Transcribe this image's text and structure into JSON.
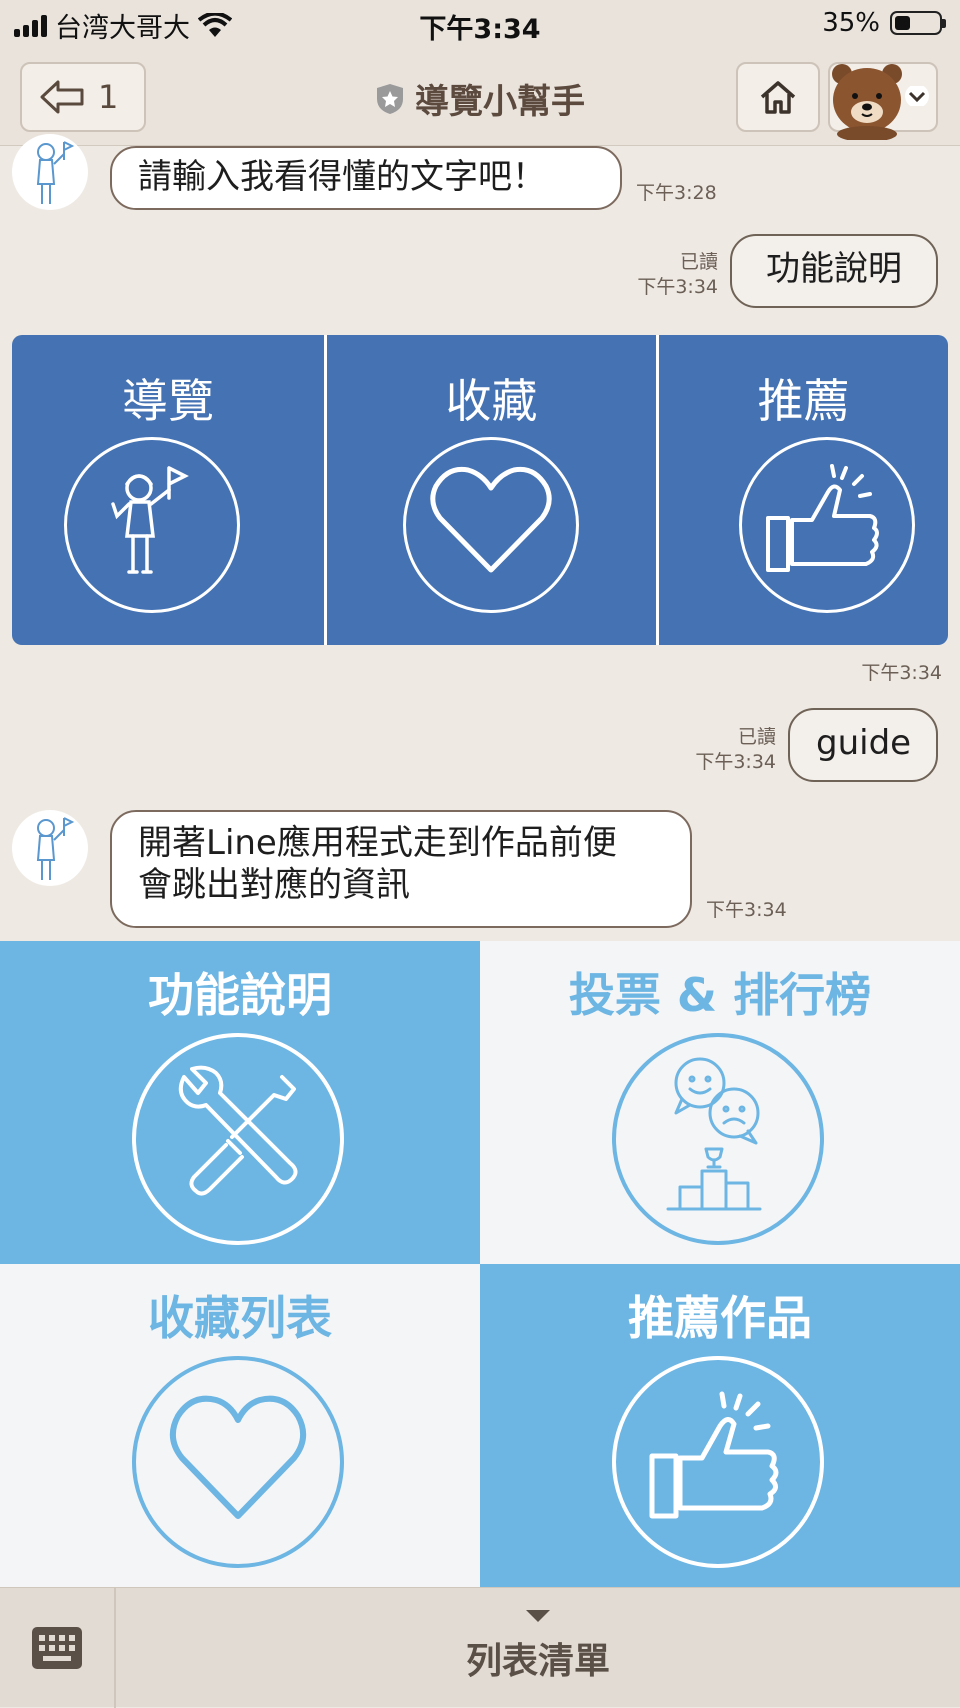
{
  "status_bar": {
    "carrier": "台湾大哥大",
    "time": "下午3:34",
    "battery_percent": "35%",
    "battery_level": 0.35
  },
  "header": {
    "back_count": "1",
    "title": "導覽小幫手"
  },
  "messages": [
    {
      "from": "bot",
      "text": "請輸入我看得懂的文字吧！",
      "time": "下午3:28"
    },
    {
      "from": "user",
      "text": "功能說明",
      "read": "已讀",
      "time": "下午3:34"
    },
    {
      "from": "bot_card",
      "time": "下午3:34"
    },
    {
      "from": "user",
      "text": "guide",
      "read": "已讀",
      "time": "下午3:34"
    },
    {
      "from": "bot",
      "text_line1": "開著Line應用程式走到作品前便",
      "text_line2": "會跳出對應的資訊",
      "time": "下午3:34"
    }
  ],
  "card": {
    "items": [
      {
        "label": "導覽",
        "icon": "guide-flag-icon"
      },
      {
        "label": "收藏",
        "icon": "heart-icon"
      },
      {
        "label": "推薦",
        "icon": "thumbs-up-icon"
      }
    ]
  },
  "rich_menu": {
    "items": [
      {
        "label": "功能說明",
        "icon": "tools-icon"
      },
      {
        "label": "投票 & 排行榜",
        "icon": "vote-ranking-icon"
      },
      {
        "label": "收藏列表",
        "icon": "heart-icon"
      },
      {
        "label": "推薦作品",
        "icon": "thumbs-up-icon"
      }
    ]
  },
  "bottom_bar": {
    "menu_label": "列表清單",
    "keyboard_icon": "keyboard-icon"
  },
  "colors": {
    "chat_bg": "#eee9e3",
    "card_blue": "#4472b3",
    "menu_blue": "#6db5e3",
    "menu_white": "#f4f5f7"
  }
}
